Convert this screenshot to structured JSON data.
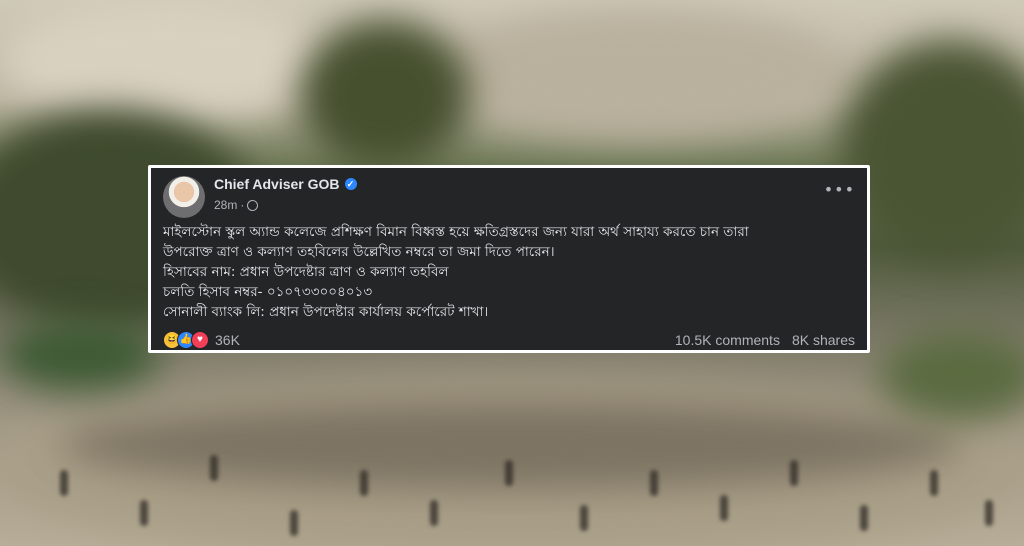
{
  "post": {
    "author": "Chief Adviser GOB",
    "time": "28m",
    "menu_glyph": "•••",
    "lines": [
      "মাইলস্টোন স্কুল অ্যান্ড কলেজে প্রশিক্ষণ বিমান বিধ্বস্ত হয়ে ক্ষতিগ্রস্তদের জন্য যারা অর্থ সাহায্য করতে চান তারা",
      "উপরোক্ত ত্রাণ ও কল্যাণ তহবিলের উল্লেখিত নম্বরে তা জমা দিতে পারেন।",
      "হিসাবের নাম: প্রধান উপদেষ্টার ত্রাণ ও কল্যাণ তহবিল",
      "চলতি হিসাব নম্বর- ০১০৭৩৩০০৪০১৩",
      "সোনালী ব্যাংক লি: প্রধান উপদেষ্টার কার্যালয় কর্পোরেট শাখা।"
    ],
    "reactions": {
      "icons": [
        "haha-icon",
        "like-icon",
        "love-icon"
      ],
      "glyphs": [
        "😆",
        "👍",
        "♥"
      ],
      "count": "36K"
    },
    "comments": "10.5K comments",
    "shares": "8K shares"
  },
  "colors": {
    "card_bg": "#242526",
    "text": "#e4e6eb",
    "muted": "#b0b3b8",
    "verified": "#2d88ff"
  }
}
